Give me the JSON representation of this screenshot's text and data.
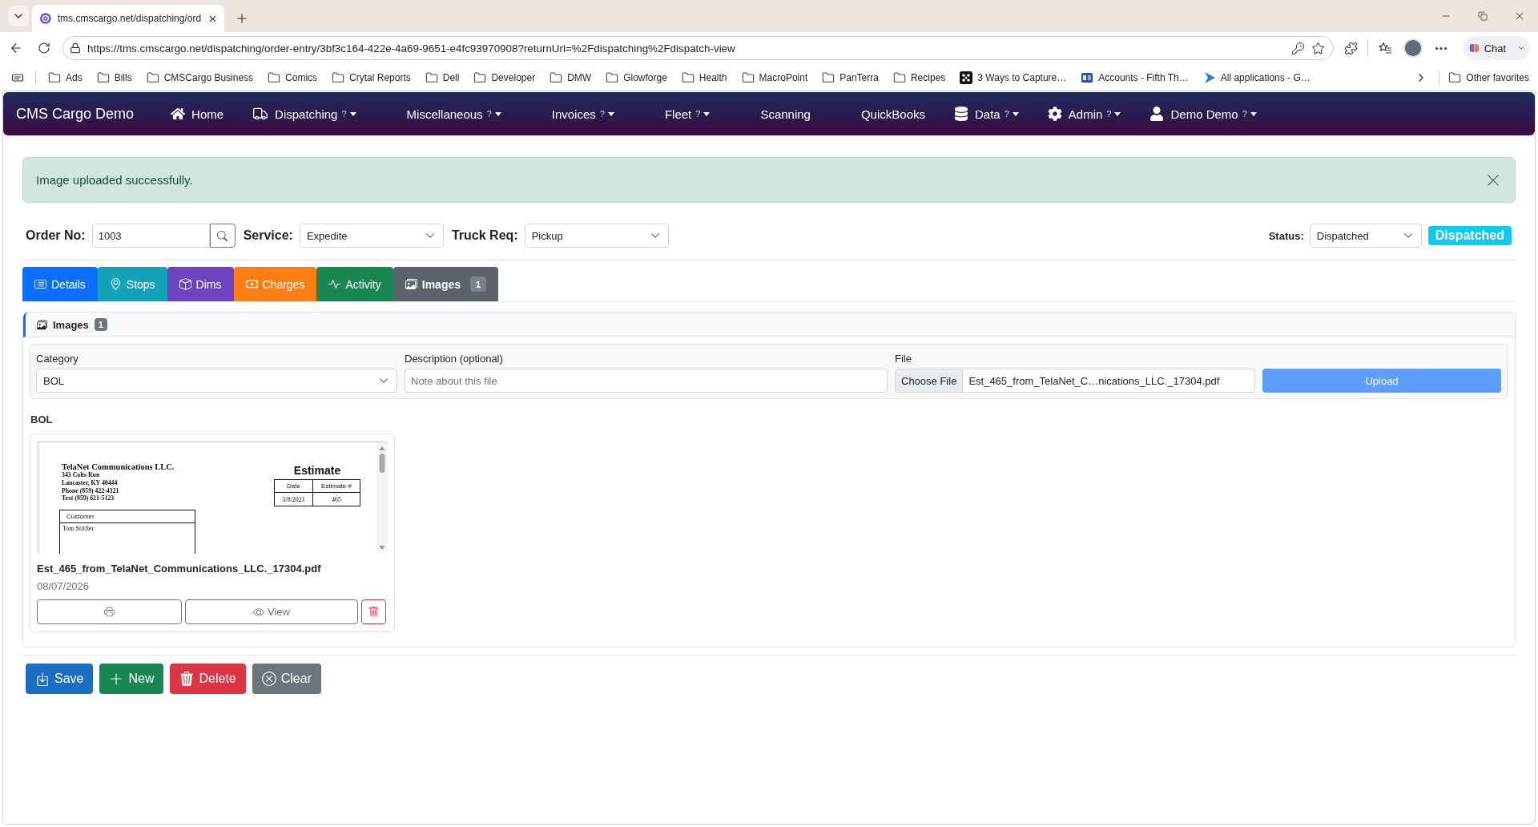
{
  "browser": {
    "tabs": [
      {
        "title": "tms.cmscargo.net/dispatching/ord",
        "selected": true
      }
    ],
    "address": "https://tms.cmscargo.net/dispatching/order-entry/3bf3c164-422e-4a69-9651-e4fc93970908?returnUrl=%2Fdispatching%2Fdispatch-view",
    "chat": "Chat",
    "bookmarks": [
      {
        "label": "Ads",
        "kind": "folder"
      },
      {
        "label": "Bills",
        "kind": "folder"
      },
      {
        "label": "CMSCargo Business",
        "kind": "folder"
      },
      {
        "label": "Comics",
        "kind": "folder"
      },
      {
        "label": "Crytal Reports",
        "kind": "folder"
      },
      {
        "label": "Dell",
        "kind": "folder"
      },
      {
        "label": "Developer",
        "kind": "folder"
      },
      {
        "label": "DMW",
        "kind": "folder"
      },
      {
        "label": "Glowforge",
        "kind": "folder"
      },
      {
        "label": "Health",
        "kind": "folder"
      },
      {
        "label": "MacroPoint",
        "kind": "folder"
      },
      {
        "label": "PanTerra",
        "kind": "folder"
      },
      {
        "label": "Recipes",
        "kind": "folder"
      },
      {
        "label": "3 Ways to Capture…",
        "kind": "link"
      },
      {
        "label": "Accounts - Fifth Th…",
        "kind": "link"
      },
      {
        "label": "All applications - G…",
        "kind": "link"
      }
    ],
    "other_favorites": "Other favorites"
  },
  "navbar": {
    "brand": "CMS Cargo Demo",
    "items": [
      {
        "label": "Home",
        "dropdown": false
      },
      {
        "label": "Dispatching",
        "help": "?",
        "dropdown": true
      },
      {
        "label": "Miscellaneous",
        "help": "?",
        "dropdown": true
      },
      {
        "label": "Invoices",
        "help": "?",
        "dropdown": true
      },
      {
        "label": "Fleet",
        "help": "?",
        "dropdown": true
      },
      {
        "label": "Scanning",
        "dropdown": false
      },
      {
        "label": "QuickBooks",
        "dropdown": false
      },
      {
        "label": "Data",
        "help": "?",
        "dropdown": true
      },
      {
        "label": "Admin",
        "help": "?",
        "dropdown": true
      },
      {
        "label": "Demo Demo",
        "help": "?",
        "dropdown": true
      }
    ]
  },
  "alert": {
    "message": "Image uploaded successfully."
  },
  "order": {
    "order_no_label": "Order No:",
    "order_no": "1003",
    "service_label": "Service:",
    "service": "Expedite",
    "truck_req_label": "Truck Req:",
    "truck_req": "Pickup",
    "status_label": "Status:",
    "status": "Dispatched",
    "status_badge": "Dispatched"
  },
  "tabs": [
    {
      "label": "Details",
      "color": "#0d6efd",
      "selected": false
    },
    {
      "label": "Stops",
      "color": "#14a2b8",
      "selected": false
    },
    {
      "label": "Dims",
      "color": "#6f42c1",
      "selected": false
    },
    {
      "label": "Charges",
      "color": "#fd7e14",
      "selected": false
    },
    {
      "label": "Activity",
      "color": "#198754",
      "selected": false
    },
    {
      "label": "Images",
      "color": "#5c636a",
      "selected": true,
      "badge": "1"
    }
  ],
  "images_panel": {
    "title": "Images",
    "count": "1",
    "form": {
      "category_label": "Category",
      "category": "BOL",
      "description_label": "Description (optional)",
      "description_placeholder": "Note about this file",
      "file_label": "File",
      "choose_file": "Choose File",
      "file_name": "Est_465_from_TelaNet_C…nications_LLC._17304.pdf",
      "upload": {
        "label": "Upload",
        "disabled": true
      }
    },
    "groups": [
      {
        "name": "BOL",
        "files": [
          {
            "preview": {
              "company": "TelaNet Communications LLC.",
              "address": [
                "343 Colts Run",
                "Lancaster, KY 40444",
                "Phone (859) 422-4321",
                "Text (859) 621-5123"
              ],
              "title": "Estimate",
              "table": {
                "columns": [
                  "Date",
                  "Estimate #"
                ],
                "row": [
                  "3/8/2021",
                  "465"
                ]
              },
              "customer_heading": "Customer",
              "customer": "Tom Stiffler"
            },
            "file_name": "Est_465_from_TelaNet_Communications_LLC._17304.pdf",
            "date": "08/07/2026",
            "view": "View"
          }
        ]
      }
    ]
  },
  "actions": [
    {
      "label": "Save",
      "color": "#1b6ec2"
    },
    {
      "label": "New",
      "color": "#198754"
    },
    {
      "label": "Delete",
      "color": "#dc3545"
    },
    {
      "label": "Clear",
      "color": "#6c757d"
    }
  ]
}
